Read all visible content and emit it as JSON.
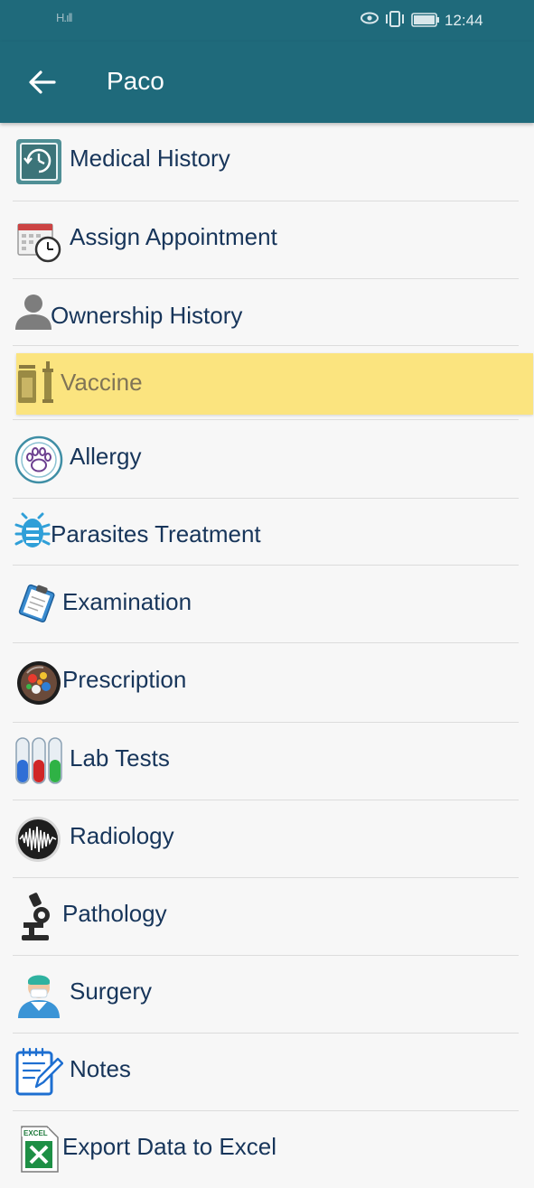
{
  "status_bar": {
    "signal": "H",
    "time": "12:44"
  },
  "app_bar": {
    "title": "Paco",
    "back_icon": "arrow-back-icon"
  },
  "menu": [
    {
      "label": "Medical History",
      "icon": "history-clock-icon"
    },
    {
      "label": "Assign Appointment",
      "icon": "calendar-clock-icon"
    },
    {
      "label": "Ownership History",
      "icon": "person-icon"
    },
    {
      "label": "Vaccine",
      "icon": "syringe-vial-icon",
      "highlighted": true
    },
    {
      "label": "Allergy",
      "icon": "paw-icon"
    },
    {
      "label": "Parasites Treatment",
      "icon": "bug-icon"
    },
    {
      "label": "Examination",
      "icon": "clipboard-icon"
    },
    {
      "label": "Prescription",
      "icon": "pills-icon"
    },
    {
      "label": "Lab Tests",
      "icon": "test-tubes-icon"
    },
    {
      "label": "Radiology",
      "icon": "waveform-icon"
    },
    {
      "label": "Pathology",
      "icon": "microscope-icon"
    },
    {
      "label": "Surgery",
      "icon": "surgeon-icon"
    },
    {
      "label": "Notes",
      "icon": "notes-icon"
    },
    {
      "label": "Export Data to Excel",
      "icon": "excel-icon"
    }
  ],
  "colors": {
    "app_bar": "#1f6a7b",
    "highlight": "#fbe47f",
    "label": "#17355a"
  }
}
